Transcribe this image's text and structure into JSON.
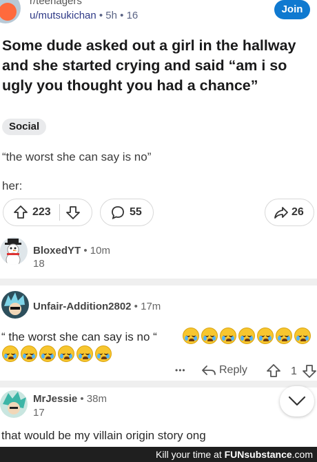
{
  "post": {
    "subreddit": "r/teenagers",
    "author": "u/mutsukichan",
    "meta": " • 5h • 16",
    "join_label": "Join",
    "title": "Some dude asked out a girl in the hallway and she started crying and said “am i so ugly you thought you had a chance”",
    "flair": "Social",
    "body_line1": "“the worst she can say is no”",
    "body_line2": "her:",
    "upvotes": "223",
    "comments": "55",
    "shares": "26"
  },
  "comments": [
    {
      "author": "BloxedYT",
      "time": " • 10m",
      "score": "18"
    },
    {
      "author": "Unfair-Addition2802",
      "time": " • 17m",
      "text": "“ the worst she can say is no “",
      "reply_label": "Reply",
      "ellipsis": "•••",
      "score": "1",
      "emoji_count": 13,
      "emoji_name": "loudly-crying-face"
    },
    {
      "author": "MrJessie",
      "time": " • 38m",
      "score": "17",
      "text": "that would be my villain origin story ong"
    }
  ],
  "footer": {
    "text": "Kill your time at ",
    "brand": "FUNsubstance",
    "tld": ".com"
  },
  "colors": {
    "join": "#0f79d0",
    "footer_bg": "#1f1f1f",
    "emoji": "#f7c62f"
  }
}
